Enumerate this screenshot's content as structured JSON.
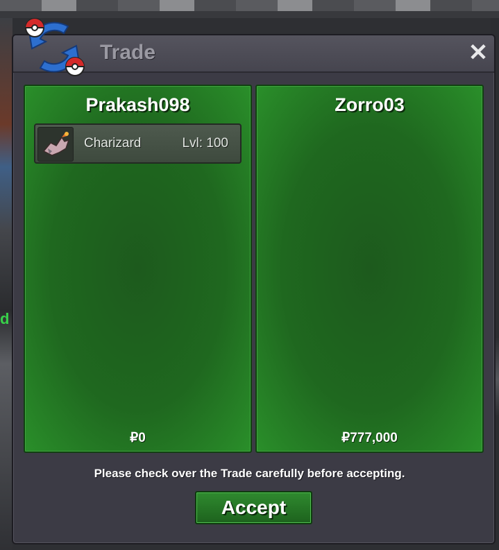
{
  "window": {
    "title": "Trade",
    "close_label": "✕"
  },
  "players": [
    {
      "name": "Prakash098",
      "money": "₽0",
      "items": [
        {
          "name": "Charizard",
          "level": "Lvl: 100",
          "icon": "charizard-sprite-icon"
        }
      ]
    },
    {
      "name": "Zorro03",
      "money": "₽777,000",
      "items": []
    }
  ],
  "footer": {
    "notice": "Please check over the Trade carefully before accepting.",
    "accept_label": "Accept"
  },
  "background": {
    "side_text": "d"
  },
  "colors": {
    "panel_green": "#1f681f",
    "accept_green": "#2f8a2f",
    "window_bg": "#3c3b45",
    "title_text": "#9a99a2"
  }
}
